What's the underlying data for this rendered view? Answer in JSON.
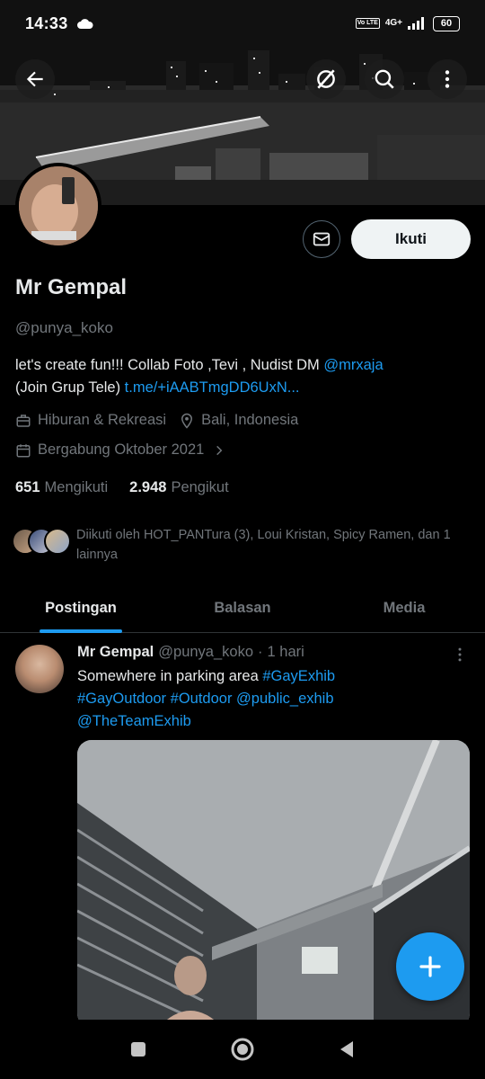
{
  "status_bar": {
    "time": "14:33",
    "volte": "Vo LTE",
    "network": "4G+",
    "battery": "60"
  },
  "profile": {
    "name": "Mr Gempal",
    "handle": "@punya_koko",
    "follow_label": "Ikuti",
    "bio": {
      "text1": "let's create fun!!! Collab Foto ,Tevi , Nudist  DM ",
      "mention": "@mrxaja",
      "text2": "(Join Grup Tele) ",
      "link": "t.me/+iAABTmgDD6UxN..."
    },
    "category": "Hiburan & Rekreasi",
    "location": "Bali, Indonesia",
    "joined": "Bergabung Oktober 2021",
    "following_count": "651",
    "following_label": "Mengikuti",
    "followers_count": "2.948",
    "followers_label": "Pengikut",
    "followed_by": "Diikuti oleh HOT_PANTura (3), Loui Kristan, Spicy Ramen, dan 1 lainnya"
  },
  "tabs": [
    {
      "label": "Postingan",
      "active": true
    },
    {
      "label": "Balasan",
      "active": false
    },
    {
      "label": "Media",
      "active": false
    }
  ],
  "post": {
    "name": "Mr Gempal",
    "handle": "@punya_koko",
    "sep": "·",
    "time": "1 hari",
    "text1": "Somewhere in parking area ",
    "tag1": "#GayExhib",
    "tag2": "#GayOutdoor",
    "tag3": "#Outdoor",
    "mention1": "@public_exhib",
    "mention2": "@TheTeamExhib"
  },
  "colors": {
    "accent": "#1d9bf0",
    "muted": "#71767b",
    "text": "#e7e9ea",
    "background": "#000000"
  },
  "icons": [
    "back-arrow-icon",
    "grok-icon",
    "search-icon",
    "more-vertical-icon",
    "mail-icon",
    "briefcase-icon",
    "location-pin-icon",
    "calendar-icon",
    "chevron-right-icon",
    "plus-icon",
    "nav-recent-icon",
    "nav-home-icon",
    "nav-back-icon"
  ]
}
